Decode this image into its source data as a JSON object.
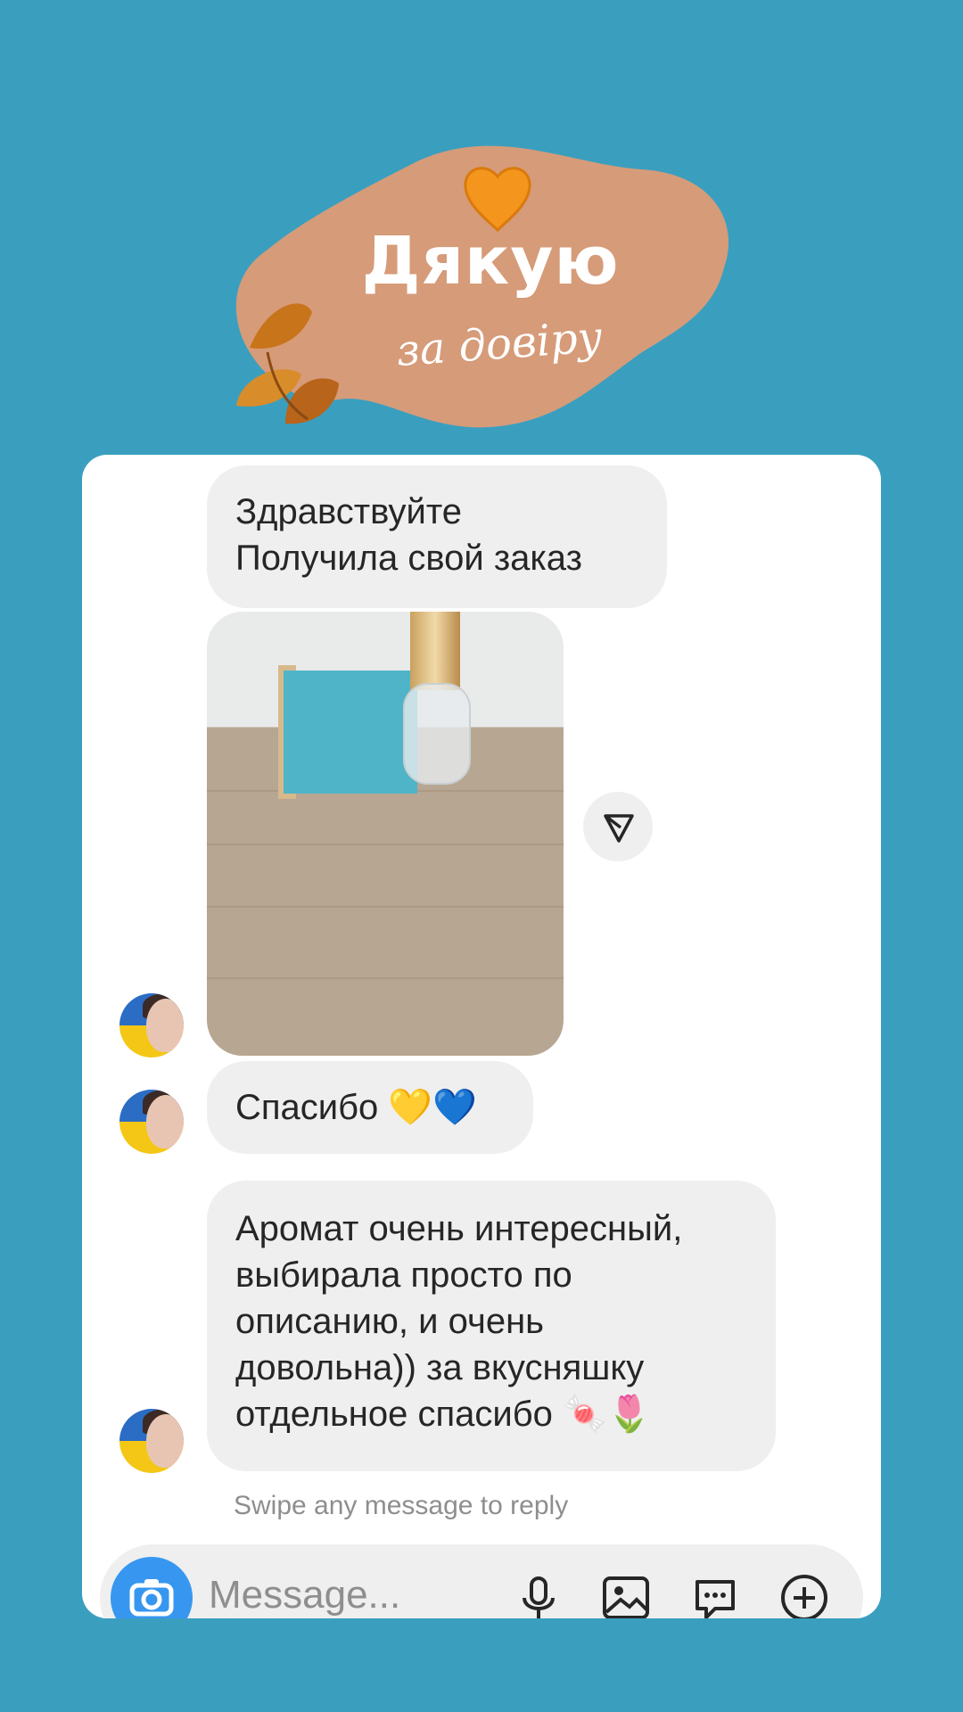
{
  "header": {
    "title": "Дякую",
    "subtitle": "за довіру"
  },
  "messages": [
    {
      "text_lines": [
        "Здравствуйте",
        "Получила свой заказ"
      ]
    },
    {
      "text": "Спасибо",
      "emoji": "💛💙"
    },
    {
      "text_lines": [
        "Аромат очень интересный,",
        "выбирала просто по",
        "описанию, и очень",
        "довольна)) за вкусняшку",
        "отдельное спасибо"
      ],
      "emoji": "🍬🌷"
    }
  ],
  "swipe_hint": "Swipe any message to reply",
  "composer": {
    "placeholder": "Message..."
  },
  "colors": {
    "background": "#3a9fbf",
    "blob": "#d69b79",
    "bubble": "#efefef",
    "camera": "#3797f0"
  },
  "icons": [
    "heart-icon",
    "leaf-icon",
    "share-icon",
    "camera-icon",
    "microphone-icon",
    "gallery-icon",
    "sticker-icon",
    "add-icon"
  ]
}
